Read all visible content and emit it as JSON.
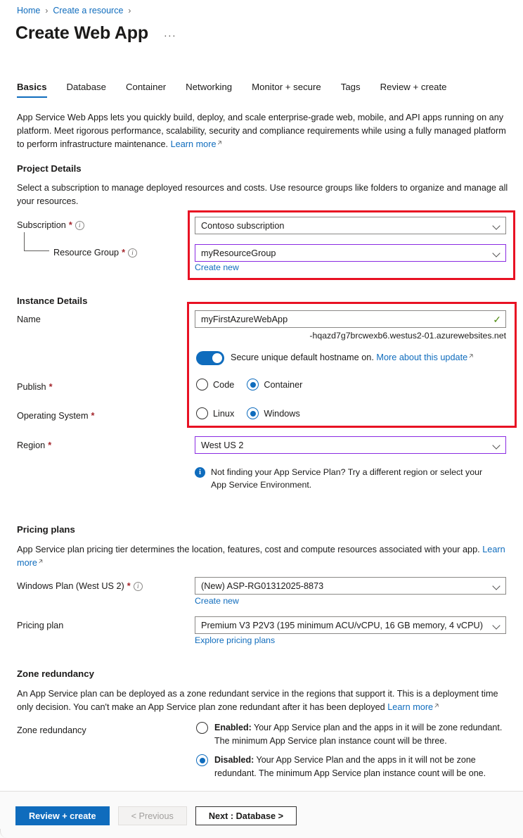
{
  "breadcrumb": {
    "home": "Home",
    "resource": "Create a resource",
    "sep": "›"
  },
  "header": {
    "title": "Create Web App",
    "ellipsis": "···"
  },
  "tabs": [
    {
      "label": "Basics",
      "active": true
    },
    {
      "label": "Database",
      "active": false
    },
    {
      "label": "Container",
      "active": false
    },
    {
      "label": "Networking",
      "active": false
    },
    {
      "label": "Monitor + secure",
      "active": false
    },
    {
      "label": "Tags",
      "active": false
    },
    {
      "label": "Review + create",
      "active": false
    }
  ],
  "intro": {
    "text": "App Service Web Apps lets you quickly build, deploy, and scale enterprise-grade web, mobile, and API apps running on any platform. Meet rigorous performance, scalability, security and compliance requirements while using a fully managed platform to perform infrastructure maintenance.",
    "link": "Learn more"
  },
  "project_details": {
    "heading": "Project Details",
    "description": "Select a subscription to manage deployed resources and costs. Use resource groups like folders to organize and manage all your resources.",
    "subscription": {
      "label": "Subscription",
      "required": "*",
      "value": "Contoso subscription"
    },
    "resource_group": {
      "label": "Resource Group",
      "required": "*",
      "value": "myResourceGroup",
      "create_new": "Create new"
    }
  },
  "instance_details": {
    "heading": "Instance Details",
    "name": {
      "label": "Name",
      "value": "myFirstAzureWebApp",
      "suffix": "-hqazd7g7brcwexb6.westus2-01.azurewebsites.net"
    },
    "hostname_toggle": {
      "state": "on",
      "text": "Secure unique default hostname on.",
      "link": "More about this update"
    },
    "publish": {
      "label": "Publish",
      "required": "*",
      "options": [
        "Code",
        "Container"
      ],
      "selected": "Container"
    },
    "operating_system": {
      "label": "Operating System",
      "required": "*",
      "options": [
        "Linux",
        "Windows"
      ],
      "selected": "Windows"
    },
    "region": {
      "label": "Region",
      "required": "*",
      "value": "West US 2"
    },
    "region_note": "Not finding your App Service Plan? Try a different region or select your App Service Environment."
  },
  "pricing_plans": {
    "heading": "Pricing plans",
    "description": "App Service plan pricing tier determines the location, features, cost and compute resources associated with your app.",
    "description_link": "Learn more",
    "windows_plan": {
      "label": "Windows Plan (West US 2)",
      "required": "*",
      "value": "(New) ASP-RG01312025-8873",
      "create_new": "Create new"
    },
    "pricing_plan": {
      "label": "Pricing plan",
      "value": "Premium V3 P2V3 (195 minimum ACU/vCPU, 16 GB memory, 4 vCPU)",
      "explore": "Explore pricing plans"
    }
  },
  "zone_redundancy": {
    "heading": "Zone redundancy",
    "description": "An App Service plan can be deployed as a zone redundant service in the regions that support it. This is a deployment time only decision. You can't make an App Service plan zone redundant after it has been deployed",
    "description_link": "Learn more",
    "label": "Zone redundancy",
    "selected": "Disabled",
    "options": [
      {
        "name": "Enabled",
        "title": "Enabled:",
        "text": " Your App Service plan and the apps in it will be zone redundant. The minimum App Service plan instance count will be three."
      },
      {
        "name": "Disabled",
        "title": "Disabled:",
        "text": " Your App Service Plan and the apps in it will not be zone redundant. The minimum App Service plan instance count will be one."
      }
    ]
  },
  "footer": {
    "review_create": "Review + create",
    "previous": "< Previous",
    "next": "Next : Database >"
  },
  "colors": {
    "accent": "#0f6cbd",
    "highlight": "#e81123",
    "focus_border": "#8a2be2",
    "required": "#a4262c",
    "valid": "#4f8a10"
  }
}
